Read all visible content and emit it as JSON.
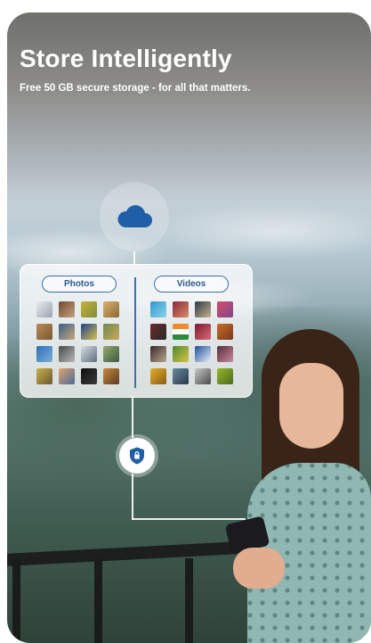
{
  "headline": "Store Intelligently",
  "subline": "Free 50 GB secure storage - for all that matters.",
  "panel": {
    "photos_label": "Photos",
    "videos_label": "Videos"
  },
  "icons": {
    "cloud": "cloud-icon",
    "shield": "shield-lock-icon"
  },
  "colors": {
    "accent": "#2c5a92",
    "pill_border": "#3f6ea8",
    "badge_icon": "#1f5fa8"
  }
}
